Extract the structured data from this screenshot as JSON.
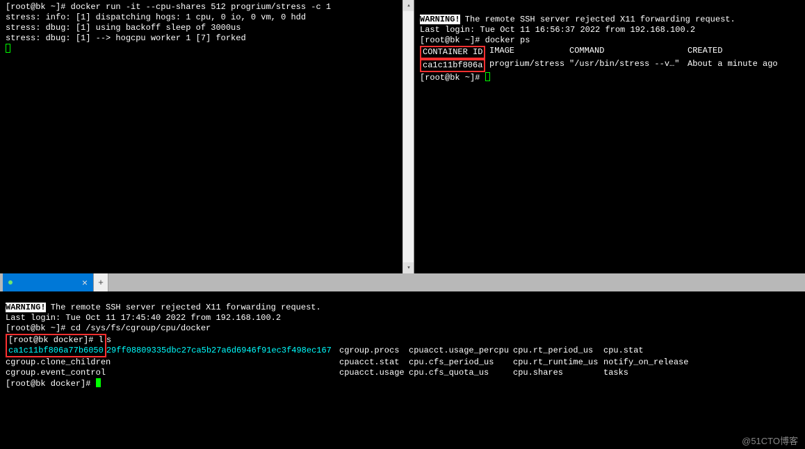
{
  "pane_left": {
    "prompt": "[root@bk ~]#",
    "cmd": "docker run -it --cpu-shares 512 progrium/stress -c 1",
    "line2": "stress: info: [1] dispatching hogs: 1 cpu, 0 io, 0 vm, 0 hdd",
    "line3": "stress: dbug: [1] using backoff sleep of 3000us",
    "line4": "stress: dbug: [1] --> hogcpu worker 1 [7] forked"
  },
  "pane_right": {
    "warn_label": "WARNING!",
    "warn_rest": " The remote SSH server rejected X11 forwarding request.",
    "login": "Last login: Tue Oct 11 16:56:37 2022 from 192.168.100.2",
    "prompt1": "[root@bk ~]#",
    "cmd1": "docker ps",
    "hdr_container": "CONTAINER ID",
    "hdr_image": "IMAGE",
    "hdr_command": "COMMAND",
    "hdr_created": "CREATED",
    "val_container": "ca1c11bf806a",
    "val_image": "progrium/stress",
    "val_command": "\"/usr/bin/stress --v…\"",
    "val_created": "About a minute ago",
    "prompt2": "[root@bk ~]#"
  },
  "tab": {
    "title": " ",
    "close": "×",
    "add": "+"
  },
  "bottom": {
    "warn_label": "WARNING!",
    "warn_rest": " The remote SSH server rejected X11 forwarding request.",
    "login": "Last login: Tue Oct 11 17:45:40 2022 from 192.168.100.2",
    "prompt1": "[root@bk ~]#",
    "cmd1": "cd /sys/fs/cgroup/cpu/docker",
    "prompt2": "[root@bk docker]#",
    "cmd2": "ls",
    "ls_shortid": "ca1c11bf806a77b6050",
    "ls_restid": "29ff08809335dbc27ca5b27a6d6946f91ec3f498ec167",
    "r1c2": "cgroup.procs",
    "r1c3": "cpuacct.usage_percpu",
    "r1c4": "cpu.rt_period_us",
    "r1c5": "cpu.stat",
    "r2c1": "cgroup.clone_children",
    "r2c2": "cpuacct.stat",
    "r2c3": "cpu.cfs_period_us",
    "r2c4": "cpu.rt_runtime_us",
    "r2c5": "notify_on_release",
    "r3c1": "cgroup.event_control",
    "r3c2": "cpuacct.usage",
    "r3c3": "cpu.cfs_quota_us",
    "r3c4": "cpu.shares",
    "r3c5": "tasks",
    "prompt3": "[root@bk docker]#"
  },
  "watermark": "@51CTO博客"
}
